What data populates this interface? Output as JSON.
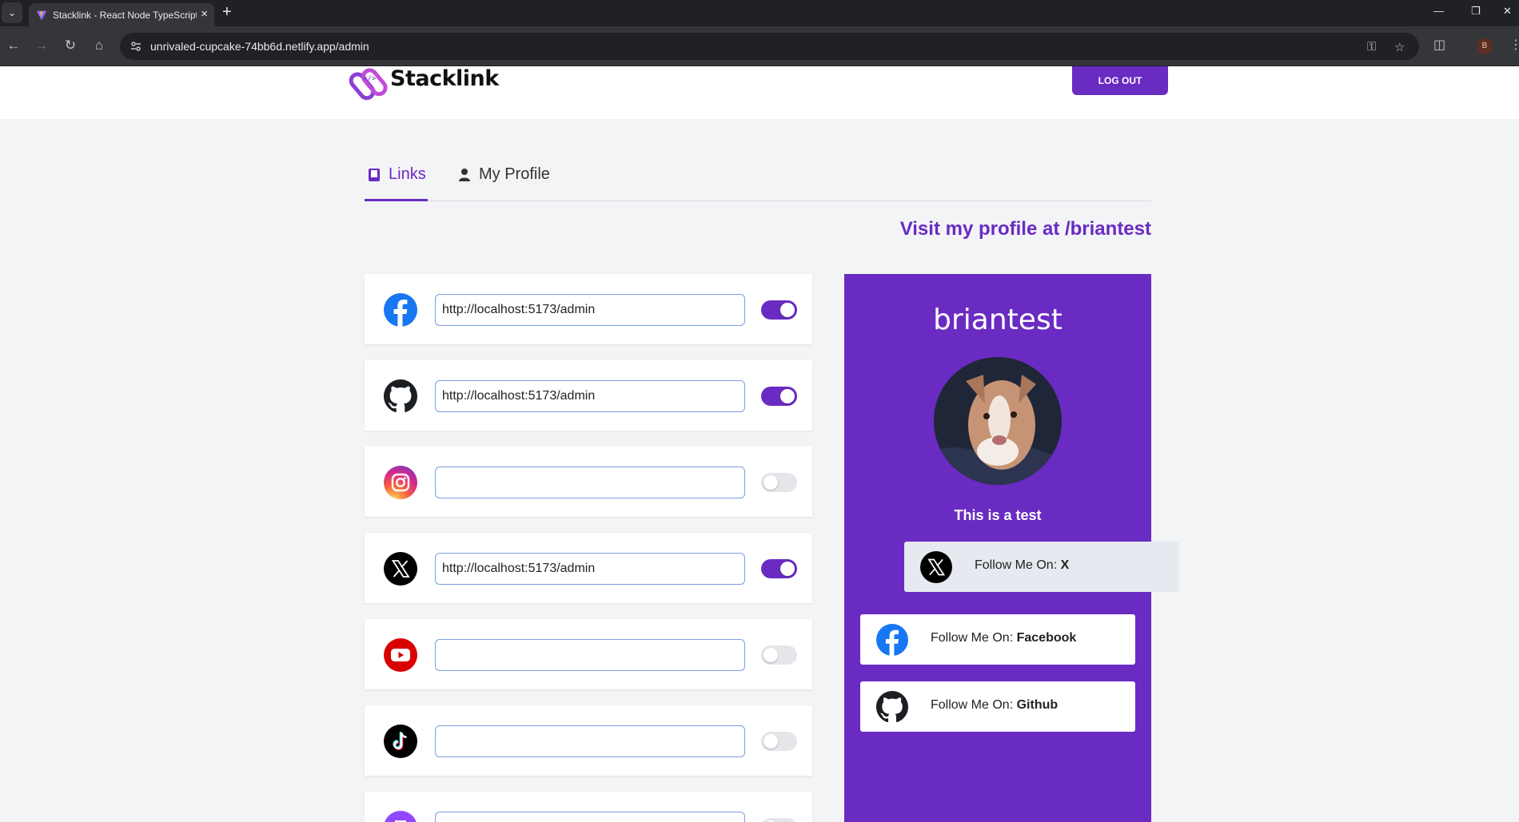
{
  "browser": {
    "tab_title": "Stacklink - React Node TypeScript",
    "url": "unrivaled-cupcake-74bb6d.netlify.app/admin",
    "profile_initial": "B"
  },
  "header": {
    "brand": "Stacklink",
    "logout_label": "LOG OUT"
  },
  "tabs": [
    {
      "label": "Links",
      "icon": "book-icon",
      "active": true
    },
    {
      "label": "My Profile",
      "icon": "person-icon",
      "active": false
    }
  ],
  "visit_text": "Visit my profile at /briantest",
  "links": [
    {
      "platform": "Facebook",
      "icon": "facebook-icon",
      "value": "http://localhost:5173/admin",
      "enabled": true
    },
    {
      "platform": "Github",
      "icon": "github-icon",
      "value": "http://localhost:5173/admin",
      "enabled": true
    },
    {
      "platform": "Instagram",
      "icon": "instagram-icon",
      "value": "",
      "enabled": false
    },
    {
      "platform": "X",
      "icon": "x-icon",
      "value": "http://localhost:5173/admin",
      "enabled": true
    },
    {
      "platform": "YouTube",
      "icon": "youtube-icon",
      "value": "",
      "enabled": false
    },
    {
      "platform": "TikTok",
      "icon": "tiktok-icon",
      "value": "",
      "enabled": false
    },
    {
      "platform": "Twitch",
      "icon": "twitch-icon",
      "value": "",
      "enabled": false
    }
  ],
  "preview": {
    "username": "briantest",
    "bio": "This is a test",
    "follow_prefix": "Follow Me On: ",
    "follow_links": [
      {
        "platform": "X",
        "icon": "x-icon"
      },
      {
        "platform": "Facebook",
        "icon": "facebook-icon"
      },
      {
        "platform": "Github",
        "icon": "github-icon"
      }
    ]
  },
  "colors": {
    "accent": "#6a2bc2",
    "facebook": "#1877f2",
    "youtube": "#ff0000"
  }
}
